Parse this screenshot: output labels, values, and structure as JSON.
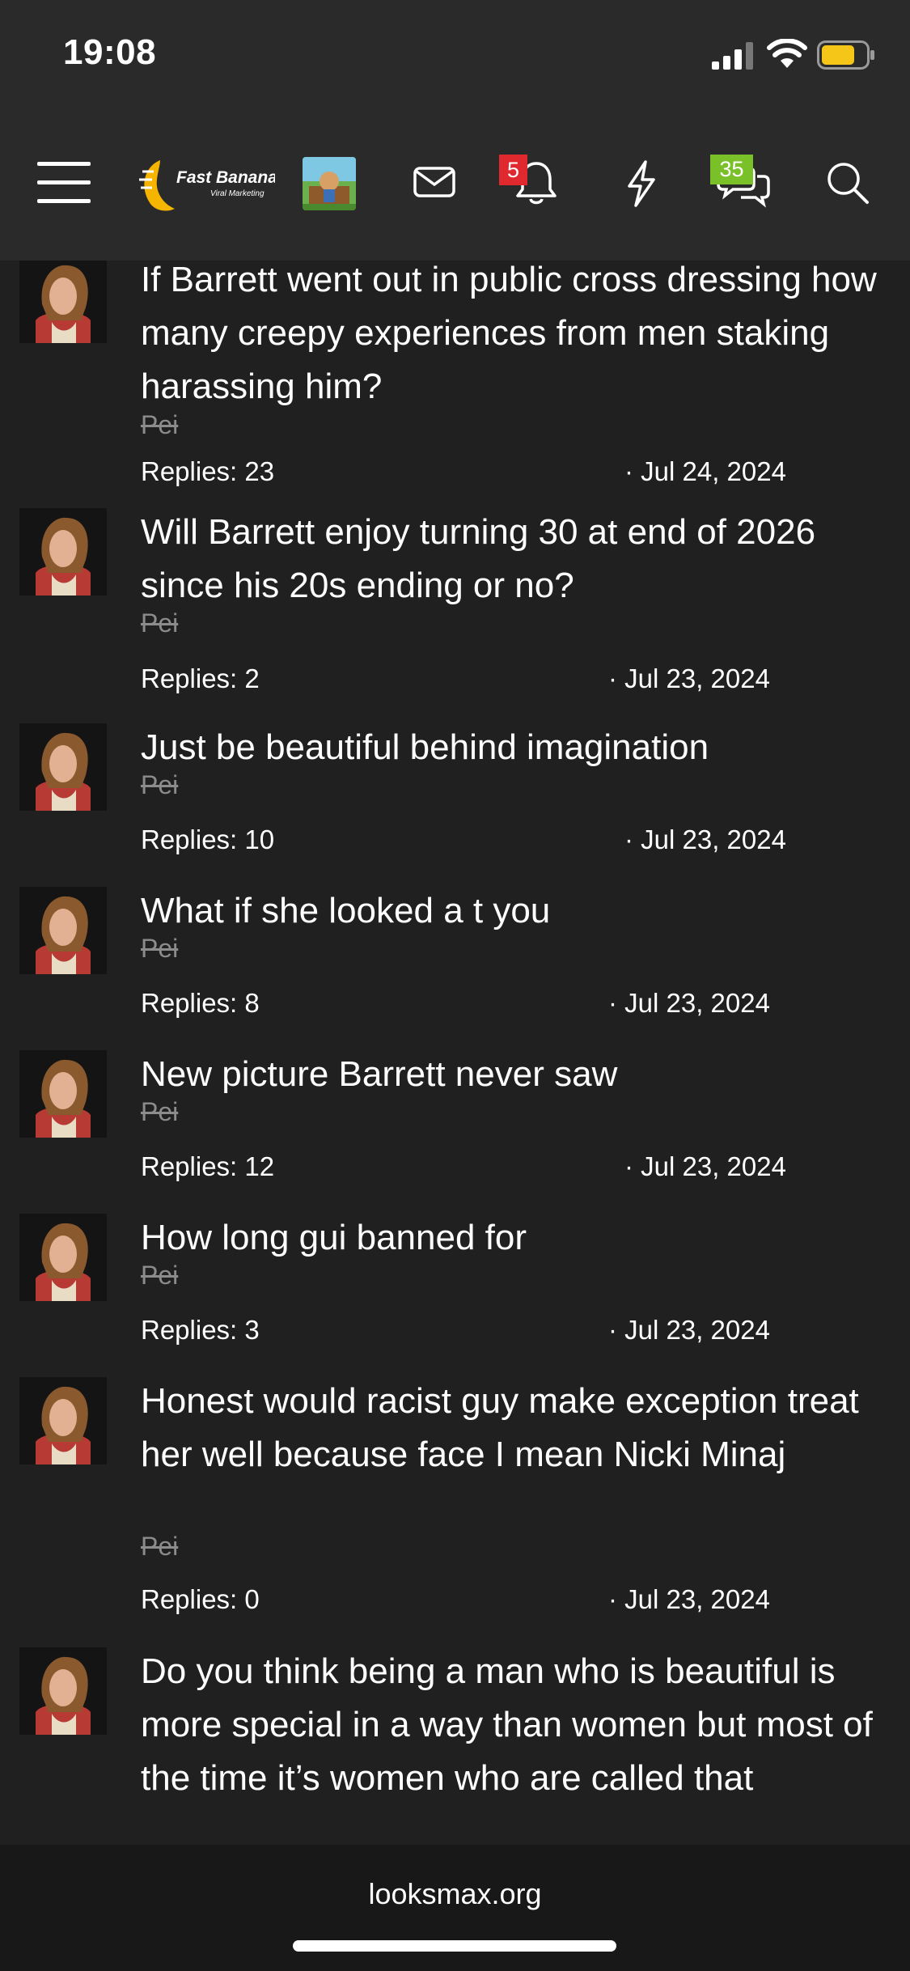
{
  "status_bar": {
    "time": "19:08",
    "battery_color": "#f5c518"
  },
  "navbar": {
    "logo_text": "Fast Banana",
    "logo_subtext": "Viral Marketing",
    "notification_badge": "5",
    "conversation_badge": "35",
    "badge_colors": {
      "notifications": "#e0282f",
      "conversations": "#7ac029"
    }
  },
  "threads": [
    {
      "title": "If Barrett went out in public cross dressing how many creepy experiences from men staking harassing him?",
      "author": "Pei",
      "replies": "Replies: 23",
      "date": "· Jul 24, 2024"
    },
    {
      "title": "Will Barrett enjoy turning 30 at end of 2026 since his 20s ending or no?",
      "author": "Pei",
      "replies": "Replies: 2",
      "date": "· Jul 23, 2024"
    },
    {
      "title": "Just be beautiful behind imagination",
      "author": "Pei",
      "replies": "Replies: 10",
      "date": "· Jul 23, 2024"
    },
    {
      "title": "What if she looked a t you",
      "author": "Pei",
      "replies": "Replies: 8",
      "date": "· Jul 23, 2024"
    },
    {
      "title": "New picture Barrett never saw",
      "author": "Pei",
      "replies": "Replies: 12",
      "date": "· Jul 23, 2024"
    },
    {
      "title": "How long gui banned for",
      "author": "Pei",
      "replies": "Replies: 3",
      "date": "· Jul 23, 2024"
    },
    {
      "title": "Honest would racist guy make exception treat her well because face I mean Nicki Minaj",
      "author": "Pei",
      "replies": "Replies: 0",
      "date": "· Jul 23, 2024"
    },
    {
      "title": "Do you think being a man who is beautiful is more special in a way than women but most of the time it’s women who are called that",
      "author": "",
      "replies": "",
      "date": ""
    }
  ],
  "browser": {
    "url": "looksmax.org"
  }
}
